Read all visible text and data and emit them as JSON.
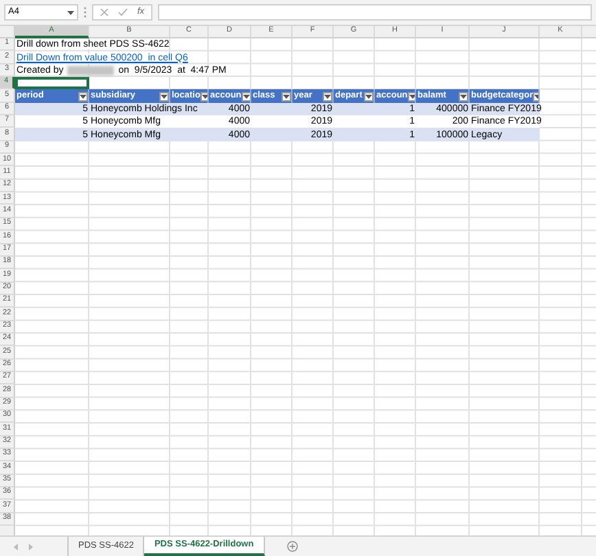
{
  "formula_bar": {
    "name_box": "A4",
    "formula_symbol": "fx"
  },
  "sheet": {
    "column_headers": [
      {
        "label": "A",
        "selected": true
      },
      {
        "label": "B",
        "selected": false
      },
      {
        "label": "C",
        "selected": false
      },
      {
        "label": "D",
        "selected": false
      },
      {
        "label": "E",
        "selected": false
      },
      {
        "label": "F",
        "selected": false
      },
      {
        "label": "G",
        "selected": false
      },
      {
        "label": "H",
        "selected": false
      },
      {
        "label": "I",
        "selected": false
      },
      {
        "label": "J",
        "selected": false
      },
      {
        "label": "K",
        "selected": false
      }
    ],
    "row_headers": [
      {
        "label": "1",
        "selected": false
      },
      {
        "label": "2",
        "selected": false
      },
      {
        "label": "3",
        "selected": false
      },
      {
        "label": "4",
        "selected": true
      },
      {
        "label": "5",
        "selected": false
      },
      {
        "label": "6",
        "selected": false
      },
      {
        "label": "7",
        "selected": false
      },
      {
        "label": "8",
        "selected": false
      },
      {
        "label": "9",
        "selected": false
      },
      {
        "label": "10",
        "selected": false
      },
      {
        "label": "11",
        "selected": false
      },
      {
        "label": "12",
        "selected": false
      },
      {
        "label": "13",
        "selected": false
      },
      {
        "label": "14",
        "selected": false
      },
      {
        "label": "15",
        "selected": false
      },
      {
        "label": "16",
        "selected": false
      },
      {
        "label": "17",
        "selected": false
      },
      {
        "label": "18",
        "selected": false
      },
      {
        "label": "19",
        "selected": false
      },
      {
        "label": "20",
        "selected": false
      },
      {
        "label": "21",
        "selected": false
      },
      {
        "label": "22",
        "selected": false
      },
      {
        "label": "23",
        "selected": false
      },
      {
        "label": "24",
        "selected": false
      },
      {
        "label": "25",
        "selected": false
      },
      {
        "label": "26",
        "selected": false
      },
      {
        "label": "27",
        "selected": false
      },
      {
        "label": "28",
        "selected": false
      },
      {
        "label": "29",
        "selected": false
      },
      {
        "label": "30",
        "selected": false
      },
      {
        "label": "31",
        "selected": false
      },
      {
        "label": "32",
        "selected": false
      },
      {
        "label": "33",
        "selected": false
      },
      {
        "label": "34",
        "selected": false
      },
      {
        "label": "35",
        "selected": false
      },
      {
        "label": "36",
        "selected": false
      },
      {
        "label": "37",
        "selected": false
      },
      {
        "label": "38",
        "selected": false
      }
    ],
    "title_line": "Drill down from sheet PDS SS-4622",
    "link": "Drill Down from value 500200  in cell Q6",
    "created": {
      "prefix": "Created by",
      "suffix": "on  9/5/2023  at  4:47 PM"
    }
  },
  "table": {
    "columns": [
      {
        "label": "period",
        "kind": "number"
      },
      {
        "label": "subsidiary",
        "kind": "text"
      },
      {
        "label": "locatio",
        "kind": "text"
      },
      {
        "label": "accoun",
        "kind": "number"
      },
      {
        "label": "class",
        "kind": "text"
      },
      {
        "label": "year",
        "kind": "number"
      },
      {
        "label": "depart",
        "kind": "text"
      },
      {
        "label": "accoun",
        "kind": "number"
      },
      {
        "label": "balamt",
        "kind": "number"
      },
      {
        "label": "budgetcategor",
        "kind": "text"
      }
    ],
    "rows": [
      {
        "cells": [
          "5",
          "Honeycomb Holdings Inc",
          null,
          "4000",
          null,
          "2019",
          null,
          "1",
          "400000",
          "Finance FY2019"
        ]
      },
      {
        "cells": [
          "5",
          "Honeycomb Mfg",
          null,
          "4000",
          null,
          "2019",
          null,
          "1",
          "200",
          "Finance FY2019"
        ]
      },
      {
        "cells": [
          "5",
          "Honeycomb Mfg",
          null,
          "4000",
          null,
          "2019",
          null,
          "1",
          "100000",
          "Legacy"
        ]
      }
    ]
  },
  "tabs": [
    {
      "label": "PDS SS-4622",
      "selected": false
    },
    {
      "label": "PDS SS-4622-Drilldown",
      "selected": true
    }
  ]
}
